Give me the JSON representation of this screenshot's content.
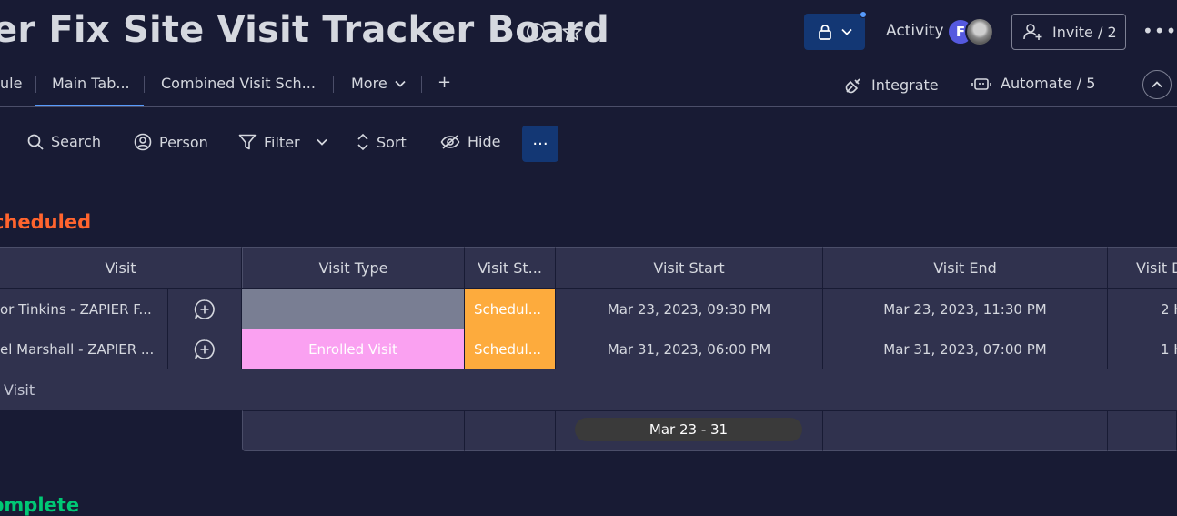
{
  "header": {
    "board_title": "er Fix Site Visit Tracker Board",
    "activity_label": "Activity",
    "avatar_initial": "F",
    "invite_label": "Invite / 2"
  },
  "tabs": [
    {
      "label": "ule"
    },
    {
      "label": "Main Tab..."
    },
    {
      "label": "Combined Visit Sch..."
    },
    {
      "label": "More"
    },
    {
      "label": "+"
    }
  ],
  "tab_actions": {
    "integrate_label": "Integrate",
    "automate_label": "Automate / 5"
  },
  "toolbar": {
    "search_label": "Search",
    "person_label": "Person",
    "filter_label": "Filter",
    "sort_label": "Sort",
    "hide_label": "Hide",
    "more_label": "···"
  },
  "groups": [
    {
      "title": "cheduled",
      "color": "#ff642e",
      "columns": [
        "Visit",
        "Visit Type",
        "Visit St...",
        "Visit Start",
        "Visit End",
        "Visit D"
      ],
      "rows": [
        {
          "visit": "or Tinkins - ZAPIER F...",
          "visit_type": "",
          "status": "Schedul...",
          "start": "Mar 23, 2023, 09:30 PM",
          "end": "Mar 23, 2023, 11:30 PM",
          "duration": "2 H"
        },
        {
          "visit": "el Marshall - ZAPIER ...",
          "visit_type": "Enrolled Visit",
          "status": "Schedul...",
          "start": "Mar 31, 2023, 06:00 PM",
          "end": "Mar 31, 2023, 07:00 PM",
          "duration": "1 H"
        }
      ],
      "add_item_label": "Visit",
      "summary_date_range": "Mar 23 - 31"
    },
    {
      "title": "omplete",
      "color": "#00c875"
    }
  ],
  "colors": {
    "background": "#181b34",
    "accent": "#579bfc",
    "status_scheduled": "#fdab3d",
    "type_enrolled": "#faa1f1"
  }
}
